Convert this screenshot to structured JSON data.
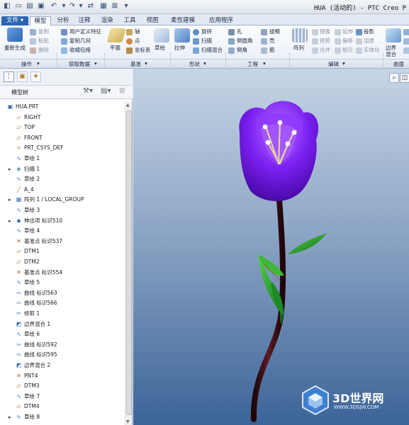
{
  "window": {
    "title": "HUA (活动的) - PTC Creo P"
  },
  "tabs": [
    "文件",
    "模型",
    "分析",
    "注释",
    "渲染",
    "工具",
    "视图",
    "柔性建模",
    "应用程序"
  ],
  "ribbon": {
    "operations": {
      "regenerate": "重新生成",
      "copy": "复制",
      "paste": "粘贴",
      "delete": "删除",
      "label": "操作"
    },
    "get_data": {
      "udf": "用户定义特征",
      "copy_geom": "复制几何",
      "shrinkwrap": "收缩包络",
      "label": "获取数据"
    },
    "datum": {
      "plane": "平面",
      "axis": "轴",
      "point": "点",
      "csys": "坐标系",
      "sketch": "草绘",
      "label": "基准"
    },
    "shapes": {
      "extrude": "拉伸",
      "revolve": "旋转",
      "sweep": "扫描",
      "swept_blend": "扫描混合",
      "label": "形状"
    },
    "engineering": {
      "hole": "孔",
      "round": "倒圆角",
      "chamfer": "倒角",
      "draft": "拔模",
      "shell": "壳",
      "rib": "筋",
      "label": "工程"
    },
    "editing": {
      "pattern": "阵列",
      "mirror": "镜像",
      "trim": "修剪",
      "merge": "合并",
      "extend": "延伸",
      "offset": "偏移",
      "intersect": "相交",
      "project": "投影",
      "thicken": "加厚",
      "solidify": "实体化",
      "label": "编辑"
    },
    "surfaces": {
      "boundary_blend": "边界混合",
      "label": "曲面"
    }
  },
  "model_tree": {
    "title": "模型树",
    "items": [
      {
        "label": "HUA.PRT",
        "icon": "part-icon",
        "expandable": false,
        "indent": 0
      },
      {
        "label": "RIGHT",
        "icon": "plane-icon",
        "expandable": false,
        "indent": 1
      },
      {
        "label": "TOP",
        "icon": "plane-icon",
        "expandable": false,
        "indent": 1
      },
      {
        "label": "FRONT",
        "icon": "plane-icon",
        "expandable": false,
        "indent": 1
      },
      {
        "label": "PRT_CSYS_DEF",
        "icon": "csys-icon",
        "expandable": false,
        "indent": 1
      },
      {
        "label": "草绘 1",
        "icon": "sketch-icon",
        "expandable": false,
        "indent": 1
      },
      {
        "label": "扫描 1",
        "icon": "sweep-icon",
        "expandable": true,
        "indent": 1
      },
      {
        "label": "草绘 2",
        "icon": "sketch-icon",
        "expandable": false,
        "indent": 1
      },
      {
        "label": "A_4",
        "icon": "axis-icon",
        "expandable": false,
        "indent": 1
      },
      {
        "label": "阵列 1 / LOCAL_GROUP",
        "icon": "pattern-icon",
        "expandable": true,
        "indent": 1
      },
      {
        "label": "草绘 3",
        "icon": "sketch-icon",
        "expandable": false,
        "indent": 1
      },
      {
        "label": "伸出项 标识510",
        "icon": "protrusion-icon",
        "expandable": true,
        "indent": 1
      },
      {
        "label": "草绘 4",
        "icon": "sketch-icon",
        "expandable": false,
        "indent": 1
      },
      {
        "label": "基准点 标识537",
        "icon": "datum-point-icon",
        "expandable": false,
        "indent": 1
      },
      {
        "label": "DTM1",
        "icon": "plane-icon",
        "expandable": false,
        "indent": 1
      },
      {
        "label": "DTM2",
        "icon": "plane-icon",
        "expandable": false,
        "indent": 1
      },
      {
        "label": "基准点 标识554",
        "icon": "datum-point-icon",
        "expandable": false,
        "indent": 1
      },
      {
        "label": "草绘 5",
        "icon": "sketch-icon",
        "expandable": false,
        "indent": 1
      },
      {
        "label": "曲线 标识563",
        "icon": "curve-icon",
        "expandable": false,
        "indent": 1
      },
      {
        "label": "曲线 标识566",
        "icon": "curve-icon",
        "expandable": false,
        "indent": 1
      },
      {
        "label": "修剪 1",
        "icon": "trim-icon",
        "expandable": false,
        "indent": 1
      },
      {
        "label": "边界混合 1",
        "icon": "boundary-blend-icon",
        "expandable": false,
        "indent": 1
      },
      {
        "label": "草绘 6",
        "icon": "sketch-icon",
        "expandable": false,
        "indent": 1
      },
      {
        "label": "曲线 标识592",
        "icon": "curve-icon",
        "expandable": false,
        "indent": 1
      },
      {
        "label": "曲线 标识595",
        "icon": "curve-icon",
        "expandable": false,
        "indent": 1
      },
      {
        "label": "边界混合 2",
        "icon": "boundary-blend-icon",
        "expandable": false,
        "indent": 1
      },
      {
        "label": "PNT4",
        "icon": "datum-point-icon",
        "expandable": false,
        "indent": 1
      },
      {
        "label": "DTM3",
        "icon": "plane-icon",
        "expandable": false,
        "indent": 1
      },
      {
        "label": "草绘 7",
        "icon": "sketch-icon",
        "expandable": false,
        "indent": 1
      },
      {
        "label": "DTM4",
        "icon": "plane-icon",
        "expandable": false,
        "indent": 1
      },
      {
        "label": "草绘 8",
        "icon": "sketch-icon",
        "expandable": true,
        "indent": 1
      }
    ]
  },
  "watermark": {
    "brand": "3D世界网",
    "url": "WWW.3DSJW.COM"
  },
  "colors": {
    "accent": "#2b65b3",
    "petal": "#7a1ff0",
    "stem": "#3a0a0e",
    "leaf": "#1e9a2a",
    "stamen": "#e8d49a"
  }
}
